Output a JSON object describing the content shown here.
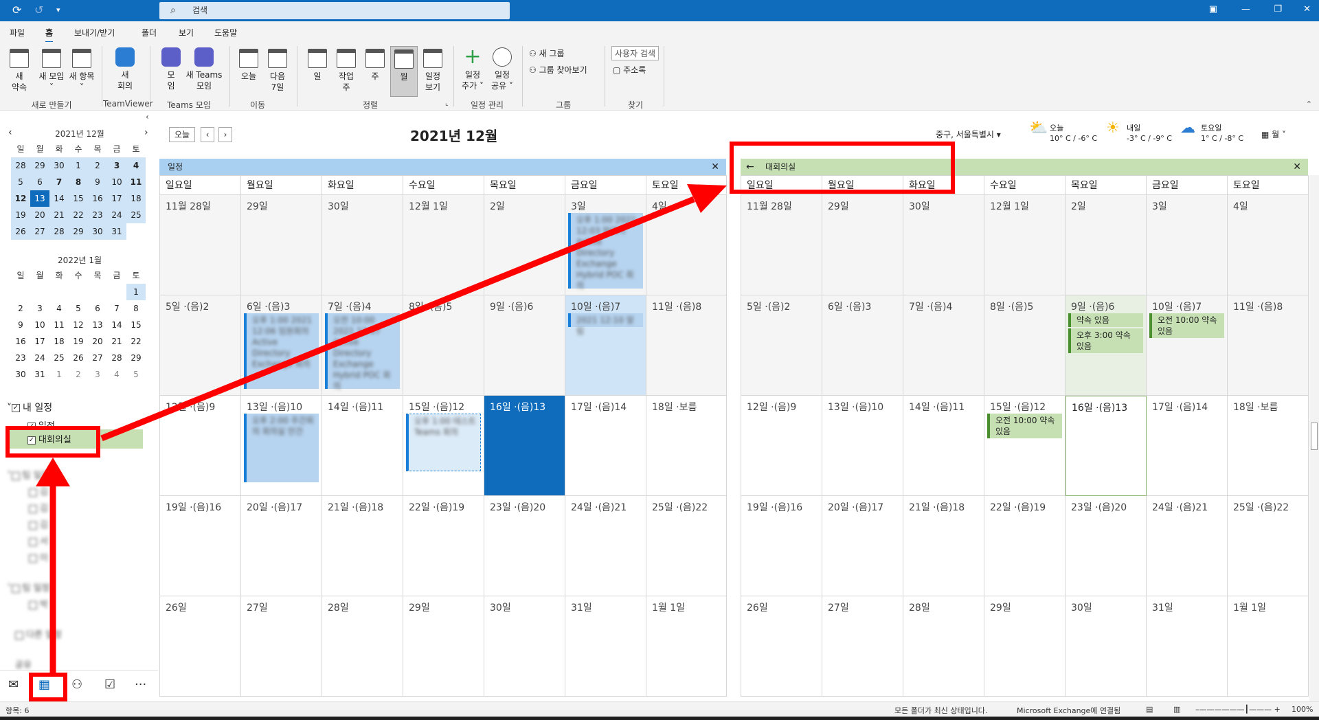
{
  "titlebar": {
    "search_placeholder": "검색"
  },
  "menu": {
    "items": [
      "파일",
      "홈",
      "보내기/받기",
      "폴더",
      "보기",
      "도움말"
    ],
    "active": "홈"
  },
  "ribbon": {
    "new_appointment": "새\n약속",
    "new_meeting": "새 모임",
    "new_items": "새 항목",
    "new_group_label": "새로 만들기",
    "teamviewer_meeting": "새\n회의",
    "teamviewer_label": "TeamViewer",
    "teams_meeting": "모\n임",
    "new_teams_meeting": "새 Teams\n모임",
    "teams_group_label": "Teams 모임",
    "today": "오늘",
    "next7": "다음\n7일",
    "goto_label": "이동",
    "day": "일",
    "workweek": "작업\n주",
    "week": "주",
    "month": "월",
    "schedule_view": "일정\n보기",
    "arrange_label": "정렬",
    "add_calendar": "일정\n추가 ˅",
    "share_calendar": "일정\n공유 ˅",
    "manage_label": "일정 관리",
    "new_group": "새 그룹",
    "browse_groups": "그룹 찾아보기",
    "groups_label": "그룹",
    "search_people": "사용자 검색",
    "address_book": "주소록",
    "find_label": "찾기"
  },
  "minical_dec": {
    "title": "2021년 12월",
    "dow": [
      "일",
      "월",
      "화",
      "수",
      "목",
      "금",
      "토"
    ],
    "days": [
      "28",
      "29",
      "30",
      "1",
      "2",
      "3",
      "4",
      "5",
      "6",
      "7",
      "8",
      "9",
      "10",
      "11",
      "12",
      "13",
      "14",
      "15",
      "16",
      "17",
      "18",
      "19",
      "20",
      "21",
      "22",
      "23",
      "24",
      "25",
      "26",
      "27",
      "28",
      "29",
      "30",
      "31",
      ""
    ]
  },
  "minical_jan": {
    "title": "2022년 1월",
    "dow": [
      "일",
      "월",
      "화",
      "수",
      "목",
      "금",
      "토"
    ],
    "days": [
      "",
      "",
      "",
      "",
      "",
      "",
      "1",
      "2",
      "3",
      "4",
      "5",
      "6",
      "7",
      "8",
      "9",
      "10",
      "11",
      "12",
      "13",
      "14",
      "15",
      "16",
      "17",
      "18",
      "19",
      "20",
      "21",
      "22",
      "23",
      "24",
      "25",
      "26",
      "27",
      "28",
      "29",
      "30",
      "31",
      "1",
      "2",
      "3",
      "4",
      "5"
    ]
  },
  "folders": {
    "my_calendars": "내 일정",
    "calendar": "일정",
    "meeting_room": "대회의실",
    "group2_blurred": "팀 일정",
    "items_blurred": [
      "김",
      "김",
      "김",
      "서",
      "이"
    ],
    "group3_blurred": "팀 일정",
    "item3_blurred": "박",
    "other_blurred": "다른 일정",
    "shared_blurred": "공유"
  },
  "header": {
    "today_btn": "오늘",
    "month_title": "2021년 12월",
    "location": "중구, 서울특별시",
    "weather": [
      {
        "day": "오늘",
        "temp": "10° C / -6° C"
      },
      {
        "day": "내일",
        "temp": "-3° C / -9° C"
      },
      {
        "day": "토요일",
        "temp": "1° C / -8° C"
      }
    ],
    "view": "월"
  },
  "left_calendar": {
    "tab": "일정",
    "dow": [
      "일요일",
      "월요일",
      "화요일",
      "수요일",
      "목요일",
      "금요일",
      "토요일"
    ],
    "weeks": [
      [
        "11월 28일",
        "29일",
        "30일",
        "12월 1일",
        "2일",
        "3일",
        "4일"
      ],
      [
        "5일 ·(음)2",
        "6일 ·(음)3",
        "7일 ·(음)4",
        "8일 ·(음)5",
        "9일 ·(음)6",
        "10일 ·(음)7",
        "11일 ·(음)8"
      ],
      [
        "12일 ·(음)9",
        "13일 ·(음)10",
        "14일 ·(음)11",
        "15일 ·(음)12",
        "16일 ·(음)13",
        "17일 ·(음)14",
        "18일 ·보름"
      ],
      [
        "19일 ·(음)16",
        "20일 ·(음)17",
        "21일 ·(음)18",
        "22일 ·(음)19",
        "23일 ·(음)20",
        "24일 ·(음)21",
        "25일 ·(음)22"
      ],
      [
        "26일",
        "27일",
        "28일",
        "29일",
        "30일",
        "31일",
        "1월 1일"
      ]
    ]
  },
  "right_calendar": {
    "tab": "대회의실",
    "dow": [
      "일요일",
      "월요일",
      "화요일",
      "수요일",
      "목요일",
      "금요일",
      "토요일"
    ],
    "weeks": [
      [
        "11월 28일",
        "29일",
        "30일",
        "12월 1일",
        "2일",
        "3일",
        "4일"
      ],
      [
        "5일 ·(음)2",
        "6일 ·(음)3",
        "7일 ·(음)4",
        "8일 ·(음)5",
        "9일 ·(음)6",
        "10일 ·(음)7",
        "11일 ·(음)8"
      ],
      [
        "12일 ·(음)9",
        "13일 ·(음)10",
        "14일 ·(음)11",
        "15일 ·(음)12",
        "16일 ·(음)13",
        "17일 ·(음)14",
        "18일 ·보름"
      ],
      [
        "19일 ·(음)16",
        "20일 ·(음)17",
        "21일 ·(음)18",
        "22일 ·(음)19",
        "23일 ·(음)20",
        "24일 ·(음)21",
        "25일 ·(음)22"
      ],
      [
        "26일",
        "27일",
        "28일",
        "29일",
        "30일",
        "31일",
        "1월 1일"
      ]
    ],
    "events": {
      "thu9_a": "약속 있음",
      "thu9_b": "오후 3:00 약속 있음",
      "fri10": "오전 10:00 약속 있음",
      "wed15": "오전 10:00 약속 있음"
    }
  },
  "blurred_events": {
    "fri3": "오후 1:00 2021 12:03 알리미 Active Directory Exchange Hybrid POC 회의",
    "mon6": "오후 1:00 2021 12:06 임원회의 Active Directory Exchange 회의",
    "tue7": "오전 10:00 2021 12:07 Active Directory Exchange Hybrid POC 회의",
    "fri10": "2021 12:10 알림",
    "mon13": "오후 2:00 주간회의 회의실 안건",
    "wed15": "오후 1:00 테스트 Teams 회의"
  },
  "statusbar": {
    "items": "항목: 6",
    "sync": "모든 폴더가 최신 상태입니다.",
    "connection": "Microsoft Exchange에 연결됨",
    "zoom": "100%"
  },
  "colors": {
    "accent": "#0f6cbd",
    "annotation": "#ff0000",
    "shared_event": "#c6e0b4",
    "own_event": "#b6d3ef"
  }
}
